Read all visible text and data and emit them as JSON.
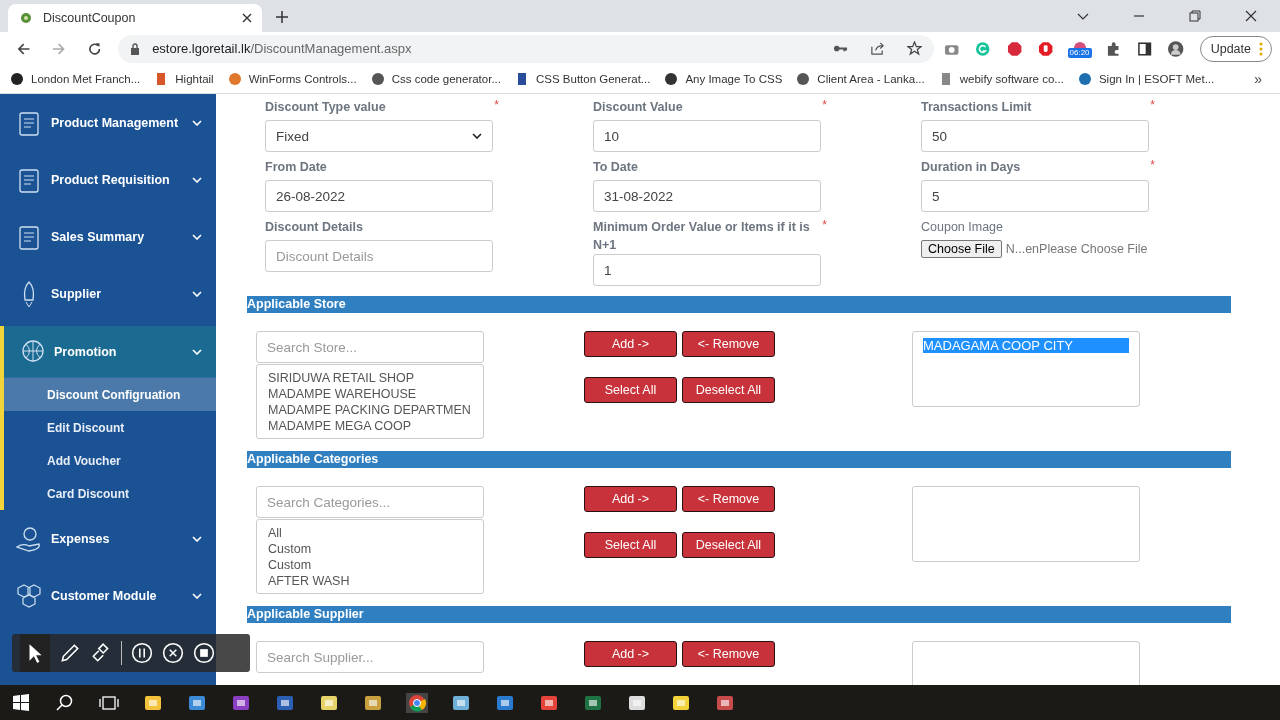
{
  "browser": {
    "tab_title": "DiscountCoupon",
    "url_host": "estore.lgoretail.lk",
    "url_path": "/DiscountManagement.aspx",
    "extension_badge": "06:20",
    "update_button": "Update",
    "bookmarks": [
      "London Met Franch...",
      "Hightail",
      "WinForms Controls...",
      "Css code generator...",
      "CSS Button Generat...",
      "Any Image To CSS",
      "Client Area - Lanka...",
      "webify software co...",
      "Sign In | ESOFT Met..."
    ],
    "more_bookmarks": "»"
  },
  "sidebar": {
    "items": [
      {
        "label": "Product Management",
        "expanded": false
      },
      {
        "label": "Product Requisition",
        "expanded": false
      },
      {
        "label": "Sales Summary",
        "expanded": false
      },
      {
        "label": "Supplier",
        "expanded": false
      },
      {
        "label": "Promotion",
        "expanded": true,
        "children": [
          {
            "label": "Discount Configruation",
            "selected": true
          },
          {
            "label": "Edit Discount",
            "selected": false
          },
          {
            "label": "Add Voucher",
            "selected": false
          },
          {
            "label": "Card Discount",
            "selected": false
          }
        ]
      },
      {
        "label": "Expenses",
        "expanded": false
      },
      {
        "label": "Customer Module",
        "expanded": false
      }
    ]
  },
  "form": {
    "fields": [
      {
        "label": "Discount Type value",
        "required_mark": "*",
        "kind": "select",
        "value": "Fixed"
      },
      {
        "label": "Discount Value",
        "required_mark": "*",
        "kind": "input",
        "value": "10"
      },
      {
        "label": "Transactions Limit",
        "required_mark": "*",
        "kind": "input",
        "value": "50"
      },
      {
        "label": "From Date",
        "kind": "input",
        "value": "26-08-2022"
      },
      {
        "label": "To Date",
        "kind": "input",
        "value": "31-08-2022"
      },
      {
        "label": "Duration in Days",
        "required_mark": "*",
        "kind": "input",
        "value": "5"
      },
      {
        "label": "Discount Details",
        "kind": "input",
        "placeholder": "Discount Details"
      },
      {
        "label": "Minimum Order Value or Items if it is N+1",
        "required_mark": "*",
        "kind": "input",
        "value": "1"
      },
      {
        "label": "Coupon Image",
        "kind": "file",
        "button": "Choose File",
        "file_text": "N...enPlease Choose File"
      }
    ]
  },
  "sections": [
    {
      "title": "Applicable Store",
      "search_placeholder": "Search Store...",
      "available": [
        "SIRIDUWA RETAIL SHOP",
        "MADAMPE WAREHOUSE",
        "MADAMPE PACKING DEPARTMEN",
        "MADAMPE MEGA COOP"
      ],
      "buttons": [
        "Add ->",
        "<- Remove",
        "Select All",
        "Deselect All"
      ],
      "chosen": [
        {
          "label": "MADAGAMA COOP CITY",
          "selected": true
        }
      ]
    },
    {
      "title": "Applicable Categories",
      "search_placeholder": "Search Categories...",
      "available": [
        "All",
        "Custom",
        "Custom",
        "AFTER WASH"
      ],
      "buttons": [
        "Add ->",
        "<- Remove",
        "Select All",
        "Deselect All"
      ]
    },
    {
      "title": "Applicable Supplier",
      "search_placeholder": "Search Supplier...",
      "buttons": [
        "Add ->",
        "<- Remove"
      ]
    }
  ]
}
